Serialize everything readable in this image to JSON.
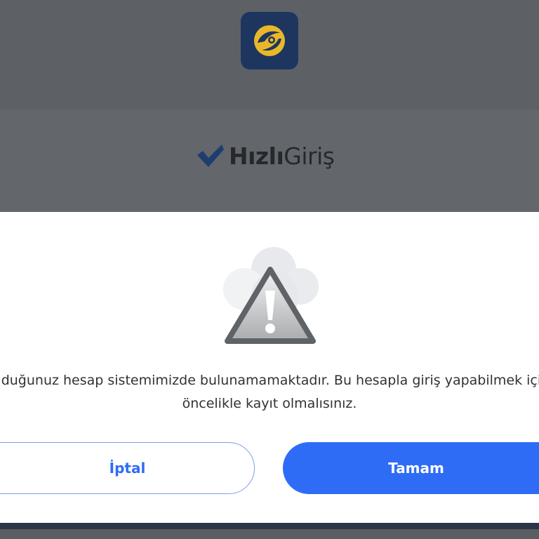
{
  "brand": {
    "bold": "Hızlı",
    "light": "Giriş"
  },
  "dialog": {
    "message_line1": "olduğunuz hesap sistemimizde bulunamamaktadır. Bu hesapla giriş yapabilmek için",
    "message_line2": "öncelikle kayıt olmalısınız.",
    "cancel_label": "İptal",
    "ok_label": "Tamam"
  },
  "icons": {
    "app_logo": "turkcell-logo-icon",
    "brand_check": "check-icon",
    "warning": "warning-triangle-icon"
  },
  "colors": {
    "primary": "#2f6cf6",
    "overlay": "#5f6367",
    "logo_bg": "#1e3560",
    "logo_fg": "#e8b829"
  }
}
